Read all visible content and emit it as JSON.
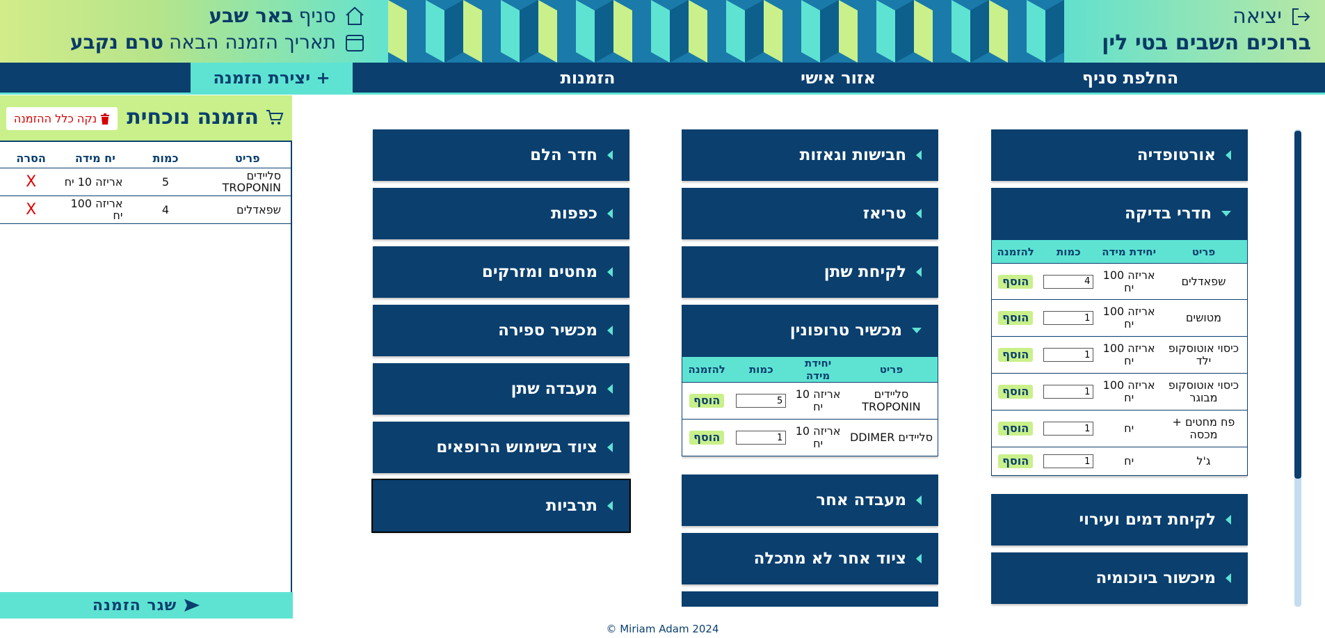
{
  "header": {
    "branch_prefix": "סניף",
    "branch_name": "באר שבע",
    "next_order_label": "תאריך הזמנה הבאה",
    "next_order_value": "טרם נקבע",
    "logout_label": "יציאה",
    "welcome": "ברוכים השבים בטי לין"
  },
  "nav": {
    "switch_branch": "החלפת סניף",
    "personal_area": "אזור אישי",
    "orders": "הזמנות",
    "create_order": "+ יצירת הזמנה"
  },
  "cart": {
    "title": "הזמנה נוכחית",
    "clear_label": "נקה כלל ההזמנה",
    "columns": {
      "item": "פריט",
      "qty": "כמות",
      "unit": "יח מידה",
      "remove": "הסרה"
    },
    "rows": [
      {
        "item": "סליידים TROPONIN",
        "qty": "5",
        "unit": "אריזה 10 יח",
        "remove": "X"
      },
      {
        "item": "שפאדלים",
        "qty": "4",
        "unit": "אריזה 100 יח",
        "remove": "X"
      }
    ],
    "submit_label": "שגר הזמנה"
  },
  "categories": {
    "col_right": {
      "orthopedics": "אורטופדיה",
      "exam_rooms": "חדרי בדיקה",
      "blood_draw": "לקיחת דמים ועירוי",
      "biochem": "מיכשור ביוכומיה"
    },
    "col_middle": {
      "bandages": "חבישות וגאזות",
      "triage": "טריאז",
      "urine": "לקיחת שתן",
      "troponin_device": "מכשיר טרופונין",
      "other_lab": "מעבדה אחר",
      "other_equipment": "ציוד אחר לא מתכלה"
    },
    "col_left": {
      "shock_room": "חדר הלם",
      "gloves": "כפפות",
      "needles": "מחטים ומזרקים",
      "counter": "מכשיר ספירה",
      "urine_lab": "מעבדה שתן",
      "doctors_equipment": "ציוד בשימוש הרופאים",
      "cultures": "תרביות"
    }
  },
  "exam_rooms_table": {
    "columns": {
      "item": "פריט",
      "unit": "יחידת מידה",
      "qty": "כמות",
      "order": "להזמנה"
    },
    "add_label": "הוסף",
    "rows": [
      {
        "item": "שפאדלים",
        "unit": "אריזה 100 יח",
        "qty": "4"
      },
      {
        "item": "מטושים",
        "unit": "אריזה 100 יח",
        "qty": "1"
      },
      {
        "item": "כיסוי אוטוסקופ ילד",
        "unit": "אריזה 100 יח",
        "qty": "1"
      },
      {
        "item": "כיסוי אוטוסקופ מבוגר",
        "unit": "אריזה 100 יח",
        "qty": "1"
      },
      {
        "item": "פח מחטים + מכסה",
        "unit": "יח",
        "qty": "1"
      },
      {
        "item": "ג'ל",
        "unit": "יח",
        "qty": "1"
      }
    ]
  },
  "troponin_table": {
    "columns": {
      "item": "פריט",
      "unit": "יחידת מידה",
      "qty": "כמות",
      "order": "להזמנה"
    },
    "add_label": "הוסף",
    "rows": [
      {
        "item": "סליידים TROPONIN",
        "unit": "אריזה 10 יח",
        "qty": "5"
      },
      {
        "item": "סליידים DDIMER",
        "unit": "אריזה 10 יח",
        "qty": "1"
      }
    ]
  },
  "footer": "© Miriam Adam 2024",
  "colors": {
    "navy": "#0a3f6e",
    "aqua": "#5ee3d3",
    "lime": "#c9f08a",
    "danger": "#e00000"
  }
}
